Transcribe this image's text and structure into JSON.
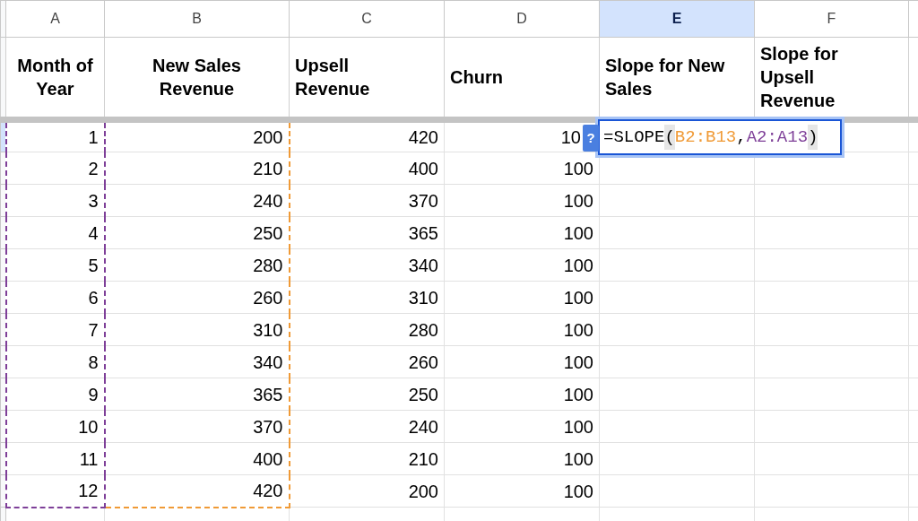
{
  "columns": [
    {
      "letter": "A",
      "header": "Month of\nYear",
      "selected": false,
      "color": "#7e3f98"
    },
    {
      "letter": "B",
      "header": "New Sales\nRevenue",
      "selected": false,
      "color": "#f09a36"
    },
    {
      "letter": "C",
      "header": "Upsell\nRevenue",
      "selected": false
    },
    {
      "letter": "D",
      "header": "Churn",
      "selected": false
    },
    {
      "letter": "E",
      "header": "Slope for New\nSales",
      "selected": true
    },
    {
      "letter": "F",
      "header": "Slope for\nUpsell\nRevenue",
      "selected": false
    }
  ],
  "rows": [
    {
      "selected": true,
      "cells": [
        "1",
        "200",
        "420",
        "10"
      ]
    },
    {
      "selected": false,
      "cells": [
        "2",
        "210",
        "400",
        "100"
      ]
    },
    {
      "selected": false,
      "cells": [
        "3",
        "240",
        "370",
        "100"
      ]
    },
    {
      "selected": false,
      "cells": [
        "4",
        "250",
        "365",
        "100"
      ]
    },
    {
      "selected": false,
      "cells": [
        "5",
        "280",
        "340",
        "100"
      ]
    },
    {
      "selected": false,
      "cells": [
        "6",
        "260",
        "310",
        "100"
      ]
    },
    {
      "selected": false,
      "cells": [
        "7",
        "310",
        "280",
        "100"
      ]
    },
    {
      "selected": false,
      "cells": [
        "8",
        "340",
        "260",
        "100"
      ]
    },
    {
      "selected": false,
      "cells": [
        "9",
        "365",
        "250",
        "100"
      ]
    },
    {
      "selected": false,
      "cells": [
        "10",
        "370",
        "240",
        "100"
      ]
    },
    {
      "selected": false,
      "cells": [
        "11",
        "400",
        "210",
        "100"
      ]
    },
    {
      "selected": false,
      "cells": [
        "12",
        "420",
        "200",
        "100"
      ]
    }
  ],
  "formula": {
    "help": "?",
    "parts": [
      {
        "kind": "plain",
        "text": "=SLOPE"
      },
      {
        "kind": "paren",
        "text": "("
      },
      {
        "kind": "range",
        "text": "B2:B13",
        "color": "#f09a36"
      },
      {
        "kind": "plain",
        "text": ","
      },
      {
        "kind": "range",
        "text": "A2:A13",
        "color": "#7e3f98"
      },
      {
        "kind": "paren",
        "text": ")"
      }
    ]
  }
}
